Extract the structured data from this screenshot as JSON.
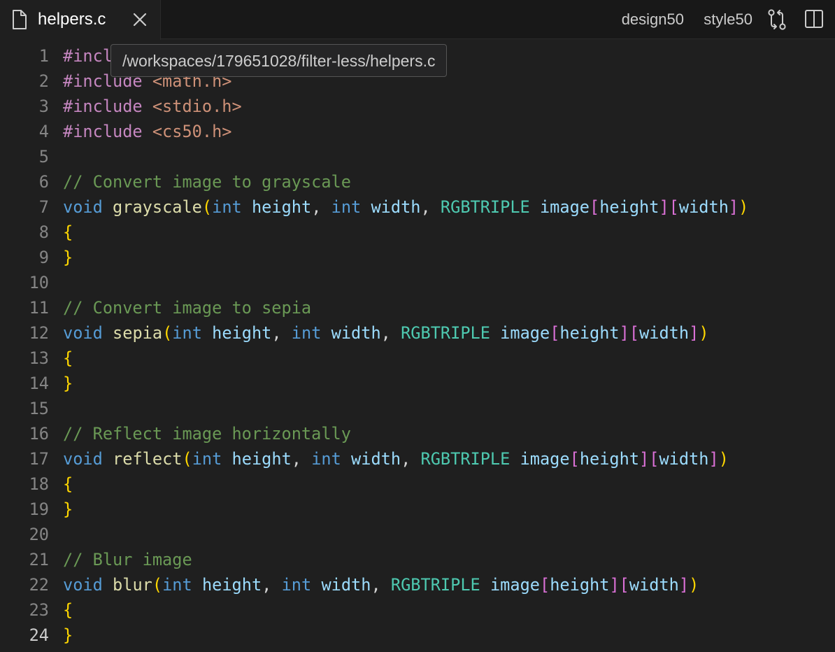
{
  "tab": {
    "filename": "helpers.c",
    "icon": "file-icon",
    "close_icon": "close-icon"
  },
  "actions": {
    "design50": "design50",
    "style50": "style50",
    "compare_icon": "source-control-compare-icon",
    "split_icon": "split-editor-icon"
  },
  "tooltip": {
    "path": "/workspaces/179651028/filter-less/helpers.c"
  },
  "editor": {
    "active_line": 24,
    "lines": [
      {
        "n": "1",
        "tokens": [
          {
            "t": "#incl",
            "c": "pp"
          }
        ]
      },
      {
        "n": "2",
        "tokens": [
          {
            "t": "#include ",
            "c": "pp"
          },
          {
            "t": "<math.h>",
            "c": "str"
          }
        ]
      },
      {
        "n": "3",
        "tokens": [
          {
            "t": "#include ",
            "c": "pp"
          },
          {
            "t": "<stdio.h>",
            "c": "str"
          }
        ]
      },
      {
        "n": "4",
        "tokens": [
          {
            "t": "#include ",
            "c": "pp"
          },
          {
            "t": "<cs50.h>",
            "c": "str"
          }
        ]
      },
      {
        "n": "5",
        "tokens": []
      },
      {
        "n": "6",
        "tokens": [
          {
            "t": "// Convert image to grayscale",
            "c": "cm"
          }
        ]
      },
      {
        "n": "7",
        "tokens": [
          {
            "t": "void",
            "c": "kw"
          },
          {
            "t": " ",
            "c": "pl"
          },
          {
            "t": "grayscale",
            "c": "fn"
          },
          {
            "t": "(",
            "c": "b1"
          },
          {
            "t": "int",
            "c": "kw"
          },
          {
            "t": " ",
            "c": "pl"
          },
          {
            "t": "height",
            "c": "id"
          },
          {
            "t": ", ",
            "c": "pl"
          },
          {
            "t": "int",
            "c": "kw"
          },
          {
            "t": " ",
            "c": "pl"
          },
          {
            "t": "width",
            "c": "id"
          },
          {
            "t": ", ",
            "c": "pl"
          },
          {
            "t": "RGBTRIPLE",
            "c": "ty"
          },
          {
            "t": " ",
            "c": "pl"
          },
          {
            "t": "image",
            "c": "id"
          },
          {
            "t": "[",
            "c": "b2"
          },
          {
            "t": "height",
            "c": "id"
          },
          {
            "t": "][",
            "c": "b2"
          },
          {
            "t": "width",
            "c": "id"
          },
          {
            "t": "]",
            "c": "b2"
          },
          {
            "t": ")",
            "c": "b1"
          }
        ]
      },
      {
        "n": "8",
        "tokens": [
          {
            "t": "{",
            "c": "b1"
          }
        ]
      },
      {
        "n": "9",
        "tokens": [
          {
            "t": "}",
            "c": "b1"
          }
        ]
      },
      {
        "n": "10",
        "tokens": []
      },
      {
        "n": "11",
        "tokens": [
          {
            "t": "// Convert image to sepia",
            "c": "cm"
          }
        ]
      },
      {
        "n": "12",
        "tokens": [
          {
            "t": "void",
            "c": "kw"
          },
          {
            "t": " ",
            "c": "pl"
          },
          {
            "t": "sepia",
            "c": "fn"
          },
          {
            "t": "(",
            "c": "b1"
          },
          {
            "t": "int",
            "c": "kw"
          },
          {
            "t": " ",
            "c": "pl"
          },
          {
            "t": "height",
            "c": "id"
          },
          {
            "t": ", ",
            "c": "pl"
          },
          {
            "t": "int",
            "c": "kw"
          },
          {
            "t": " ",
            "c": "pl"
          },
          {
            "t": "width",
            "c": "id"
          },
          {
            "t": ", ",
            "c": "pl"
          },
          {
            "t": "RGBTRIPLE",
            "c": "ty"
          },
          {
            "t": " ",
            "c": "pl"
          },
          {
            "t": "image",
            "c": "id"
          },
          {
            "t": "[",
            "c": "b2"
          },
          {
            "t": "height",
            "c": "id"
          },
          {
            "t": "][",
            "c": "b2"
          },
          {
            "t": "width",
            "c": "id"
          },
          {
            "t": "]",
            "c": "b2"
          },
          {
            "t": ")",
            "c": "b1"
          }
        ]
      },
      {
        "n": "13",
        "tokens": [
          {
            "t": "{",
            "c": "b1"
          }
        ]
      },
      {
        "n": "14",
        "tokens": [
          {
            "t": "}",
            "c": "b1"
          }
        ]
      },
      {
        "n": "15",
        "tokens": []
      },
      {
        "n": "16",
        "tokens": [
          {
            "t": "// Reflect image horizontally",
            "c": "cm"
          }
        ]
      },
      {
        "n": "17",
        "tokens": [
          {
            "t": "void",
            "c": "kw"
          },
          {
            "t": " ",
            "c": "pl"
          },
          {
            "t": "reflect",
            "c": "fn"
          },
          {
            "t": "(",
            "c": "b1"
          },
          {
            "t": "int",
            "c": "kw"
          },
          {
            "t": " ",
            "c": "pl"
          },
          {
            "t": "height",
            "c": "id"
          },
          {
            "t": ", ",
            "c": "pl"
          },
          {
            "t": "int",
            "c": "kw"
          },
          {
            "t": " ",
            "c": "pl"
          },
          {
            "t": "width",
            "c": "id"
          },
          {
            "t": ", ",
            "c": "pl"
          },
          {
            "t": "RGBTRIPLE",
            "c": "ty"
          },
          {
            "t": " ",
            "c": "pl"
          },
          {
            "t": "image",
            "c": "id"
          },
          {
            "t": "[",
            "c": "b2"
          },
          {
            "t": "height",
            "c": "id"
          },
          {
            "t": "][",
            "c": "b2"
          },
          {
            "t": "width",
            "c": "id"
          },
          {
            "t": "]",
            "c": "b2"
          },
          {
            "t": ")",
            "c": "b1"
          }
        ]
      },
      {
        "n": "18",
        "tokens": [
          {
            "t": "{",
            "c": "b1"
          }
        ]
      },
      {
        "n": "19",
        "tokens": [
          {
            "t": "}",
            "c": "b1"
          }
        ]
      },
      {
        "n": "20",
        "tokens": []
      },
      {
        "n": "21",
        "tokens": [
          {
            "t": "// Blur image",
            "c": "cm"
          }
        ]
      },
      {
        "n": "22",
        "tokens": [
          {
            "t": "void",
            "c": "kw"
          },
          {
            "t": " ",
            "c": "pl"
          },
          {
            "t": "blur",
            "c": "fn"
          },
          {
            "t": "(",
            "c": "b1"
          },
          {
            "t": "int",
            "c": "kw"
          },
          {
            "t": " ",
            "c": "pl"
          },
          {
            "t": "height",
            "c": "id"
          },
          {
            "t": ", ",
            "c": "pl"
          },
          {
            "t": "int",
            "c": "kw"
          },
          {
            "t": " ",
            "c": "pl"
          },
          {
            "t": "width",
            "c": "id"
          },
          {
            "t": ", ",
            "c": "pl"
          },
          {
            "t": "RGBTRIPLE",
            "c": "ty"
          },
          {
            "t": " ",
            "c": "pl"
          },
          {
            "t": "image",
            "c": "id"
          },
          {
            "t": "[",
            "c": "b2"
          },
          {
            "t": "height",
            "c": "id"
          },
          {
            "t": "][",
            "c": "b2"
          },
          {
            "t": "width",
            "c": "id"
          },
          {
            "t": "]",
            "c": "b2"
          },
          {
            "t": ")",
            "c": "b1"
          }
        ]
      },
      {
        "n": "23",
        "tokens": [
          {
            "t": "{",
            "c": "b1"
          }
        ]
      },
      {
        "n": "24",
        "tokens": [
          {
            "t": "}",
            "c": "b1"
          }
        ]
      }
    ]
  }
}
